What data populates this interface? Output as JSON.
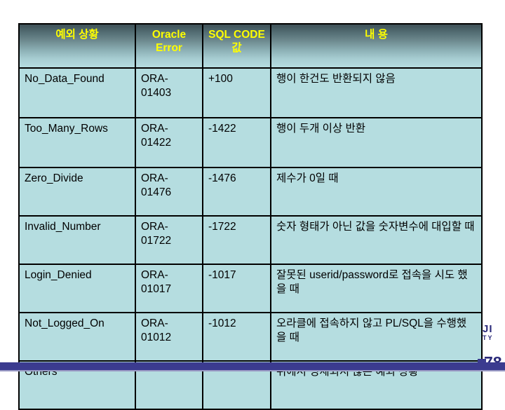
{
  "slide": {
    "page_number": "78",
    "logo_fragment_line1": "JI",
    "logo_fragment_line2": "TY",
    "accent_bar_color": "#3b3b8f",
    "header_text_color": "#ffff00",
    "cell_background_color": "#b5dde0",
    "border_color": "#000000"
  },
  "table": {
    "name": "oracle-predefined-exceptions",
    "headers": {
      "exception": "예외 상황",
      "oracle_error": "Oracle Error",
      "sqlcode": "SQL CODE값",
      "description": "내 용"
    },
    "rows": [
      {
        "exception": "No_Data_Found",
        "oracle_error": "ORA-01403",
        "sqlcode": "+100",
        "description": "행이 한건도 반환되지 않음"
      },
      {
        "exception": "Too_Many_Rows",
        "oracle_error": "ORA-01422",
        "sqlcode": "-1422",
        "description": "행이 두개 이상 반환"
      },
      {
        "exception": "Zero_Divide",
        "oracle_error": "ORA-01476",
        "sqlcode": "-1476",
        "description": "제수가 0일 때"
      },
      {
        "exception": "Invalid_Number",
        "oracle_error": "ORA-01722",
        "sqlcode": "-1722",
        "description": "숫자 형태가 아닌 값을 숫자변수에 대입할 때"
      },
      {
        "exception": "Login_Denied",
        "oracle_error": "ORA-01017",
        "sqlcode": "-1017",
        "description": "잘못된 userid/password로 접속을 시도 했을 때"
      },
      {
        "exception": "Not_Logged_On",
        "oracle_error": "ORA-01012",
        "sqlcode": "-1012",
        "description": "오라클에 접속하지 않고 PL/SQL을 수행했을 때"
      },
      {
        "exception": "Others",
        "oracle_error": "",
        "sqlcode": "",
        "description": "위에서 명세되지 않은 예외 상황"
      }
    ]
  }
}
